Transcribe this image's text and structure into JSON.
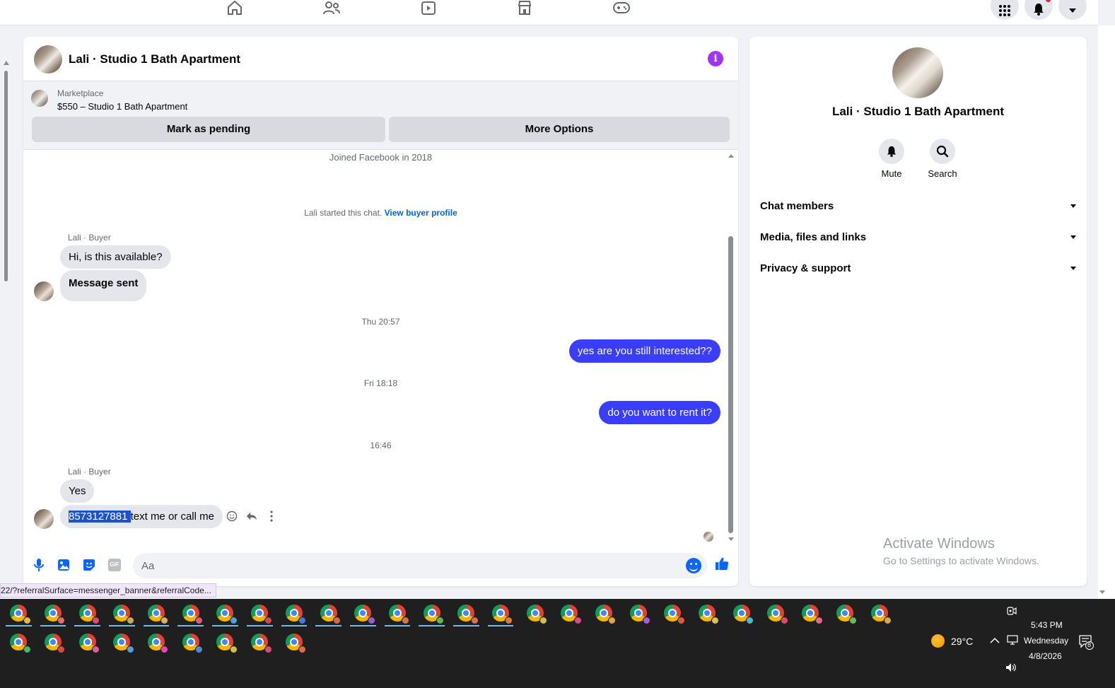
{
  "topnav": {
    "icons": [
      "home-icon",
      "friends-icon",
      "video-icon",
      "marketplace-icon",
      "gaming-icon"
    ],
    "right_icons": [
      "menu-grid-icon",
      "notifications-icon",
      "account-chevron-icon"
    ]
  },
  "chat": {
    "title": "Lali · Studio 1 Bath Apartment",
    "marketplace_label": "Marketplace",
    "listing": "$550 – Studio 1 Bath Apartment",
    "mark_pending_label": "Mark as pending",
    "more_options_label": "More Options",
    "joined": "Joined Facebook in 2018",
    "started_text": "Lali started this chat.",
    "view_profile": "View buyer profile",
    "sender_label_1": "Lali · Buyer",
    "msg_1": "Hi, is this available?",
    "msg_2": "Message sent",
    "time_1": "Thu 20:57",
    "out_1": "yes are you still interested??",
    "time_2": "Fri 18:18",
    "out_2": "do you want to rent it?",
    "time_3": "16:46",
    "sender_label_2": "Lali · Buyer",
    "msg_3": "Yes",
    "msg_4_selected": "8573127881 ",
    "msg_4_rest": "text me or call me",
    "composer_placeholder": "Aa",
    "composer_gif": "GIF"
  },
  "side": {
    "title": "Lali · Studio 1 Bath Apartment",
    "mute_label": "Mute",
    "search_label": "Search",
    "sections": [
      "Chat members",
      "Media, files and links",
      "Privacy & support"
    ],
    "watermark_title": "Activate Windows",
    "watermark_sub": "Go to Settings to activate Windows."
  },
  "status_url": "22/?referralSurface=messenger_banner&referralCode...",
  "taskbar": {
    "row1_count": 26,
    "row2_count": 9,
    "weather_temp": "29°C",
    "time": "5:43 PM",
    "day": "Wednesday",
    "date": "4/8/2026",
    "notification_count": "8"
  },
  "colors": {
    "accent": "#0866ff",
    "outgoing_bubble": "#3a3dfa",
    "incoming_bubble": "#e4e6eb",
    "info_icon": "#a033ff",
    "taskbar_bg": "#1f1f1f"
  }
}
